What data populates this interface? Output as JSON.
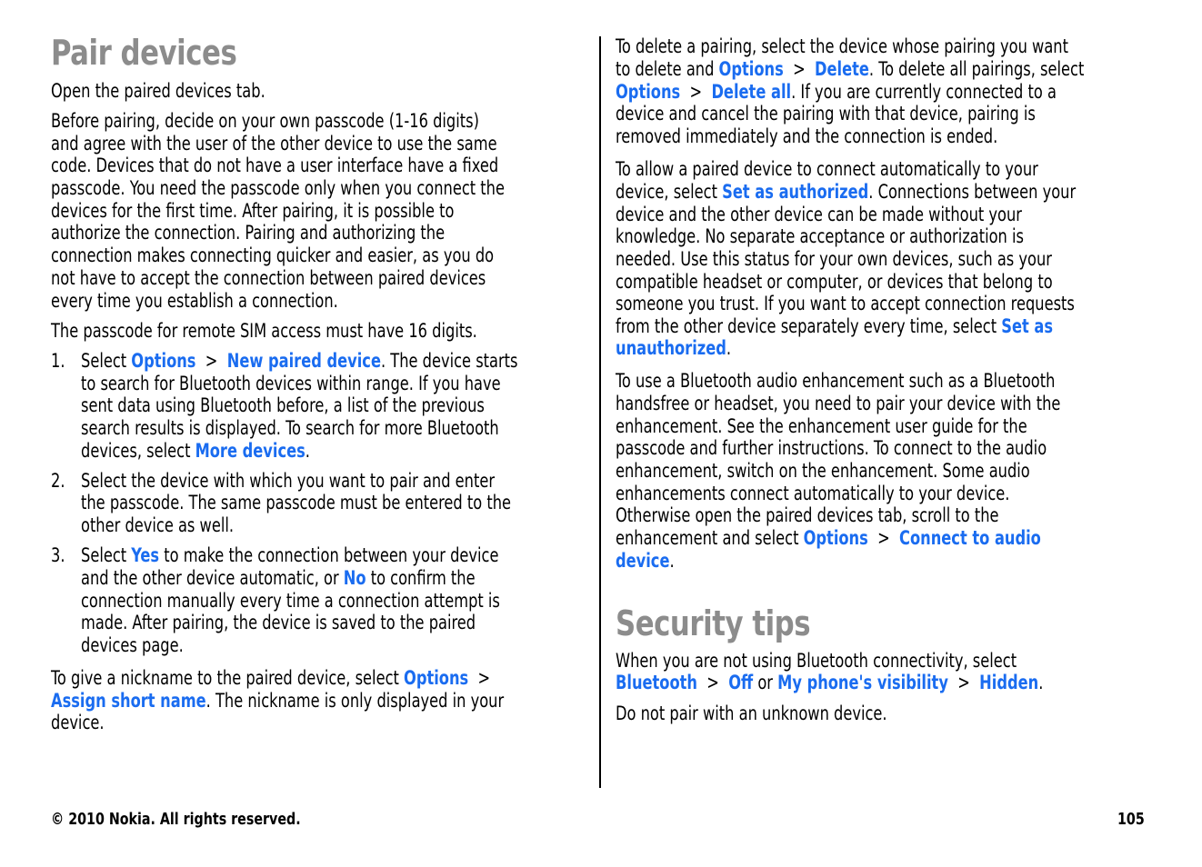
{
  "left": {
    "heading": "Pair devices",
    "p1": "Open the paired devices tab.",
    "p2_lines": [
      "Before pairing, decide on your own passcode (1-16 digits)",
      "and agree with the user of the other device to use the same",
      "code. Devices that do not have a user interface have a fixed",
      "passcode. You need the passcode only when you connect the",
      "devices for the first time. After pairing, it is possible to",
      "authorize the connection. Pairing and authorizing the",
      "connection makes connecting quicker and easier, as you do",
      "not have to accept the connection between paired devices",
      "every time you establish a connection."
    ],
    "p3": "The passcode for remote SIM access must have 16 digits.",
    "steps": [
      {
        "num": "1.",
        "l1_pre": "Select ",
        "l1_k1": "Options",
        "l1_sep": "  >  ",
        "l1_k2": "New paired device",
        "l1_post": ". The device starts",
        "lines": [
          "to search for Bluetooth devices within range. If you have",
          "sent data using Bluetooth before, a list of the previous",
          "search results is displayed. To search for more Bluetooth"
        ],
        "last_pre": "devices, select ",
        "last_k": "More devices",
        "last_post": "."
      },
      {
        "num": "2.",
        "lines": [
          "Select the device with which you want to pair and enter",
          "the passcode. The same passcode must be entered to the",
          "other device as well."
        ]
      },
      {
        "num": "3.",
        "l1_pre": "Select ",
        "l1_k": "Yes",
        "l1_post": " to make the connection between your device",
        "l2_pre": "and the other device automatic, or ",
        "l2_k": "No",
        "l2_post": " to confirm the",
        "lines": [
          "connection manually every time a connection attempt is",
          "made. After pairing, the device is saved to the paired",
          "devices page."
        ]
      }
    ],
    "p4": {
      "l1_pre": "To give a nickname to the paired device, select ",
      "l1_k": "Options",
      "l1_sep": "  >",
      "l2_k": "Assign short name",
      "l2_post": ". The nickname is only displayed in your",
      "l3": "device."
    }
  },
  "right": {
    "p1": {
      "l1": "To delete a pairing, select the device whose pairing you want",
      "l2_pre": "to delete and ",
      "l2_k1": "Options",
      "l2_sep": "  >  ",
      "l2_k2": "Delete",
      "l2_post": ". To delete all pairings, select",
      "l3_k1": "Options",
      "l3_sep": "  >  ",
      "l3_k2": "Delete all",
      "l3_post": ". If you are currently connected to a",
      "l4": "device and cancel the pairing with that device, pairing is",
      "l5": "removed immediately and the connection is ended."
    },
    "p2": {
      "l1": "To allow a paired device to connect automatically to your",
      "l2_pre": "device, select ",
      "l2_k": "Set as authorized",
      "l2_post": ". Connections between your",
      "lines": [
        "device and the other device can be made without your",
        "knowledge. No separate acceptance or authorization is",
        "needed. Use this status for your own devices, such as your",
        "compatible headset or computer, or devices that belong to",
        "someone you trust. If you want to accept connection requests"
      ],
      "l8_pre": "from the other device separately every time, select ",
      "l8_k": "Set as",
      "l9_k": "unauthorized",
      "l9_post": "."
    },
    "p3": {
      "lines": [
        "To use a Bluetooth audio enhancement such as a Bluetooth",
        "handsfree or headset, you need to pair your device with the",
        "enhancement. See the enhancement user guide for the",
        "passcode and further instructions. To connect to the audio",
        "enhancement, switch on the enhancement. Some audio",
        "enhancements connect automatically to your device.",
        "Otherwise open the paired devices tab, scroll to the"
      ],
      "l8_pre": "enhancement and select ",
      "l8_k1": "Options",
      "l8_sep": "  >  ",
      "l8_k2": "Connect to audio",
      "l9_k": "device",
      "l9_post": "."
    },
    "heading": "Security tips",
    "p4": {
      "l1": "When you are not using Bluetooth connectivity, select",
      "l2_k1": "Bluetooth",
      "l2_sep1": "  >  ",
      "l2_k2": "Off",
      "l2_mid": " or ",
      "l2_k3": "My phone's visibility",
      "l2_sep2": "  >  ",
      "l2_k4": "Hidden",
      "l2_post": "."
    },
    "p5": "Do not pair with an unknown device."
  },
  "footer": {
    "copyright": "© 2010 Nokia. All rights reserved.",
    "page_number": "105"
  },
  "colors": {
    "keyword": "#1a6cf0",
    "heading": "#8c8c8c"
  }
}
